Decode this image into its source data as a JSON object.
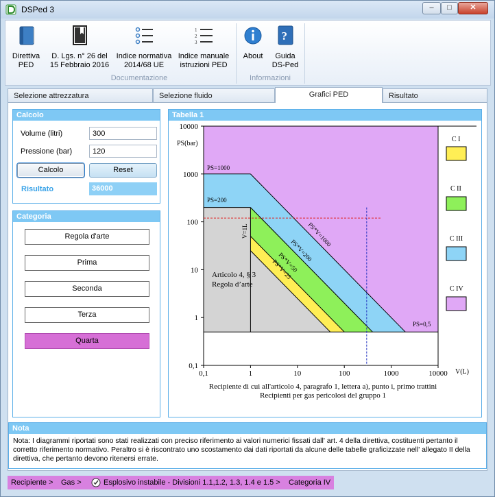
{
  "window": {
    "title": "DSPed 3"
  },
  "ribbon": {
    "buttons": [
      {
        "label": "Direttiva\nPED",
        "icon": "book-icon"
      },
      {
        "label": "D. Lgs. n° 26 del\n15 Febbraio 2016",
        "icon": "bookmark-book-icon"
      },
      {
        "label": "Indice normativa\n2014/68 UE",
        "icon": "bulleted-list-icon"
      },
      {
        "label": "Indice manuale\nistruzioni PED",
        "icon": "numbered-list-icon"
      },
      {
        "label": "About",
        "icon": "info-icon"
      },
      {
        "label": "Guida\nDS-Ped",
        "icon": "help-book-icon"
      }
    ],
    "groups": [
      "Documentazione",
      "Informazioni"
    ]
  },
  "tabs": [
    "Selezione attrezzatura",
    "Selezione fluido",
    "Grafici PED",
    "Risultato"
  ],
  "active_tab": "Grafici PED",
  "calcolo": {
    "title": "Calcolo",
    "volume_label": "Volume (litri)",
    "volume_value": "300",
    "pressione_label": "Pressione (bar)",
    "pressione_value": "120",
    "calcolo_button": "Calcolo",
    "reset_button": "Reset",
    "risultato_label": "Risultato",
    "risultato_value": "36000"
  },
  "categoria": {
    "title": "Categoria",
    "items": [
      "Regola d'arte",
      "Prima",
      "Seconda",
      "Terza",
      "Quarta"
    ],
    "selected": "Quarta",
    "selected_color": "#d66fd6"
  },
  "tabella": {
    "title": "Tabella 1",
    "ylabel": "PS(bar)",
    "xlabel": "V(L)",
    "y_ticks": [
      "10000",
      "1000",
      "100",
      "10",
      "1",
      "0,1"
    ],
    "x_ticks": [
      "0,1",
      "1",
      "10",
      "100",
      "1000",
      "10000"
    ],
    "line_labels": {
      "ps1000": "PS=1000",
      "ps200": "PS=200",
      "ps05": "PS=0,5",
      "v1": "V=1L",
      "psv1000": "PS*V=1000",
      "psv200": "PS*V=200",
      "psv50": "PS*V=50",
      "psv25": "PS*V=25"
    },
    "region_label_1": "Articolo 4, § 3",
    "region_label_2": "Regola d’arte",
    "legend": [
      {
        "label": "C I",
        "color": "#ffee55"
      },
      {
        "label": "C II",
        "color": "#8ef05a"
      },
      {
        "label": "C III",
        "color": "#8ed4f6"
      },
      {
        "label": "C IV",
        "color": "#e0a8f6"
      }
    ],
    "colors": {
      "cat4": "#e0a8f6",
      "cat3": "#8ed4f6",
      "cat2": "#8ef05a",
      "cat1": "#ffee55",
      "regola": "#d4d4d4",
      "marker_h": "#e02020",
      "marker_v": "#2030c0"
    },
    "caption_1": "Recipiente di cui all'articolo 4, paragrafo 1, lettera a), punto i, primo trattini",
    "caption_2": "Recipienti per gas pericolosi del gruppo 1"
  },
  "chart_data": {
    "type": "area",
    "title": "Tabella 1",
    "xlabel": "V(L)",
    "ylabel": "PS(bar)",
    "x_scale": "log",
    "y_scale": "log",
    "xlim": [
      0.1,
      10000
    ],
    "ylim": [
      0.1,
      10000
    ],
    "boundaries": [
      {
        "name": "PS=1000",
        "type": "horizontal",
        "y": 1000
      },
      {
        "name": "PS=200",
        "type": "horizontal",
        "y": 200
      },
      {
        "name": "PS=0,5",
        "type": "horizontal",
        "y": 0.5
      },
      {
        "name": "V=1L",
        "type": "vertical",
        "x": 1
      },
      {
        "name": "PS*V=1000",
        "type": "hyperbola",
        "k": 1000
      },
      {
        "name": "PS*V=200",
        "type": "hyperbola",
        "k": 200
      },
      {
        "name": "PS*V=50",
        "type": "hyperbola",
        "k": 50
      },
      {
        "name": "PS*V=25",
        "type": "hyperbola",
        "k": 25
      }
    ],
    "legend": [
      "C I",
      "C II",
      "C III",
      "C IV"
    ],
    "marker": {
      "V": 300,
      "PS": 120
    }
  },
  "nota": {
    "title": "Nota",
    "text": "Nota: I diagrammi riportati sono stati realizzati con preciso riferimento ai valori numerici fissati dall' art. 4 della direttiva, costituenti pertanto il corretto riferimento normativo. Peraltro si è riscontrato uno scostamento dai dati riportati da alcune delle tabelle graficizzate nell' allegato II della direttiva, che pertanto devono ritenersi errate."
  },
  "statusbar": {
    "recipiente": "Recipiente >",
    "gas": "Gas >",
    "esplosivo": "Esplosivo instabile - Divisioni 1.1,1.2, 1.3, 1.4 e 1.5 >",
    "categoria": "Categoria IV"
  }
}
